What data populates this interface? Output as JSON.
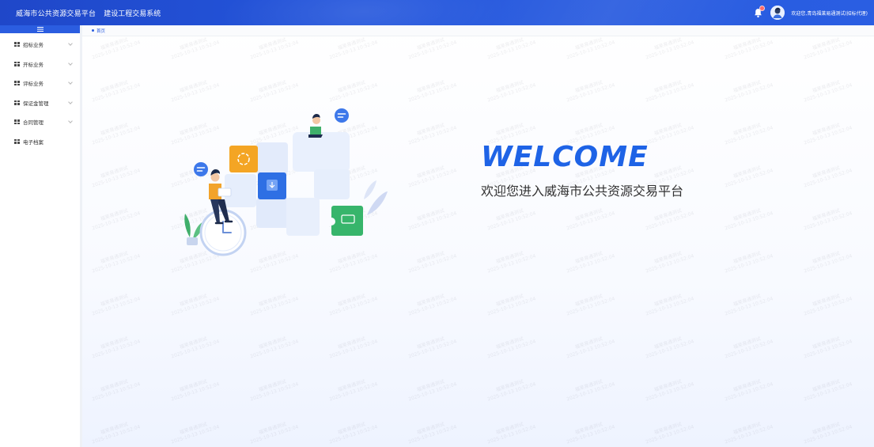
{
  "header": {
    "title": "威海市公共资源交易平台",
    "subtitle": "建设工程交易系统",
    "user": "欢迎您,青岛福莱易通测试(招标代理)",
    "icons": {
      "notification": "bell-icon",
      "avatar": "user-avatar-icon"
    },
    "accent": "#2456dc"
  },
  "sidebar": {
    "collapse_icon": "menu-icon",
    "items": [
      {
        "label": "招标业务",
        "has_children": true
      },
      {
        "label": "开标业务",
        "has_children": true
      },
      {
        "label": "评标业务",
        "has_children": true
      },
      {
        "label": "保证金管理",
        "has_children": true
      },
      {
        "label": "合同管理",
        "has_children": true
      },
      {
        "label": "电子档案",
        "has_children": false
      }
    ]
  },
  "tabs": [
    {
      "label": "首页",
      "active": true
    }
  ],
  "welcome": {
    "title": "WELCOME",
    "subtitle": "欢迎您进入威海市公共资源交易平台",
    "title_color": "#1e63e6"
  },
  "watermark": {
    "line1": "福莱易通测试",
    "line2": "2025-10-13 10:52:04"
  }
}
